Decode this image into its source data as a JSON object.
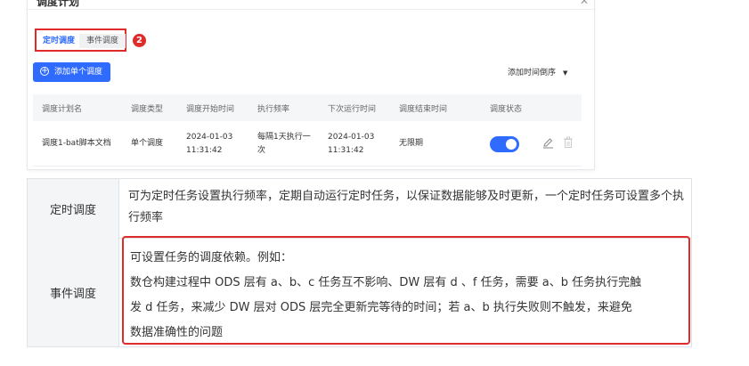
{
  "panel": {
    "title": "调度计划",
    "close": "✕",
    "tabs": [
      {
        "label": "定时调度",
        "active": true
      },
      {
        "label": "事件调度",
        "active": false
      }
    ],
    "badge": "2",
    "add_button": "添加单个调度",
    "sort_label": "添加时间倒序",
    "columns": [
      "调度计划名",
      "调度类型",
      "调度开始时间",
      "执行频率",
      "下次运行时间",
      "调度结束时间",
      "调度状态"
    ],
    "rows": [
      {
        "name": "调度1-bat脚本文档",
        "type": "单个调度",
        "start_date": "2024-01-03",
        "start_time": "11:31:42",
        "freq_1": "每隔1天执行一",
        "freq_2": "次",
        "next_date": "2024-01-03",
        "next_time": "11:31:42",
        "end": "无限期",
        "status_on": true
      }
    ]
  },
  "explanation": {
    "timed_label": "定时调度",
    "timed_text": "可为定时任务设置执行频率，定期自动运行定时任务，以保证数据能够及时更新，一个定时任务可设置多个执行频率",
    "event_label": "事件调度",
    "event_lines": [
      "可设置任务的调度依赖。例如：",
      "数仓构建过程中 ODS 层有 a、b、c 任务互不影响、DW 层有 d 、f 任务，需要 a、b 任务执行完触",
      "发 d 任务，来减少 DW 层对 ODS 层完全更新完等待的时间；若 a、b 执行失败则不触发，来避免",
      "数据准确性的问题"
    ]
  },
  "colors": {
    "accent": "#2f6bff",
    "highlight": "#e02b2b"
  }
}
